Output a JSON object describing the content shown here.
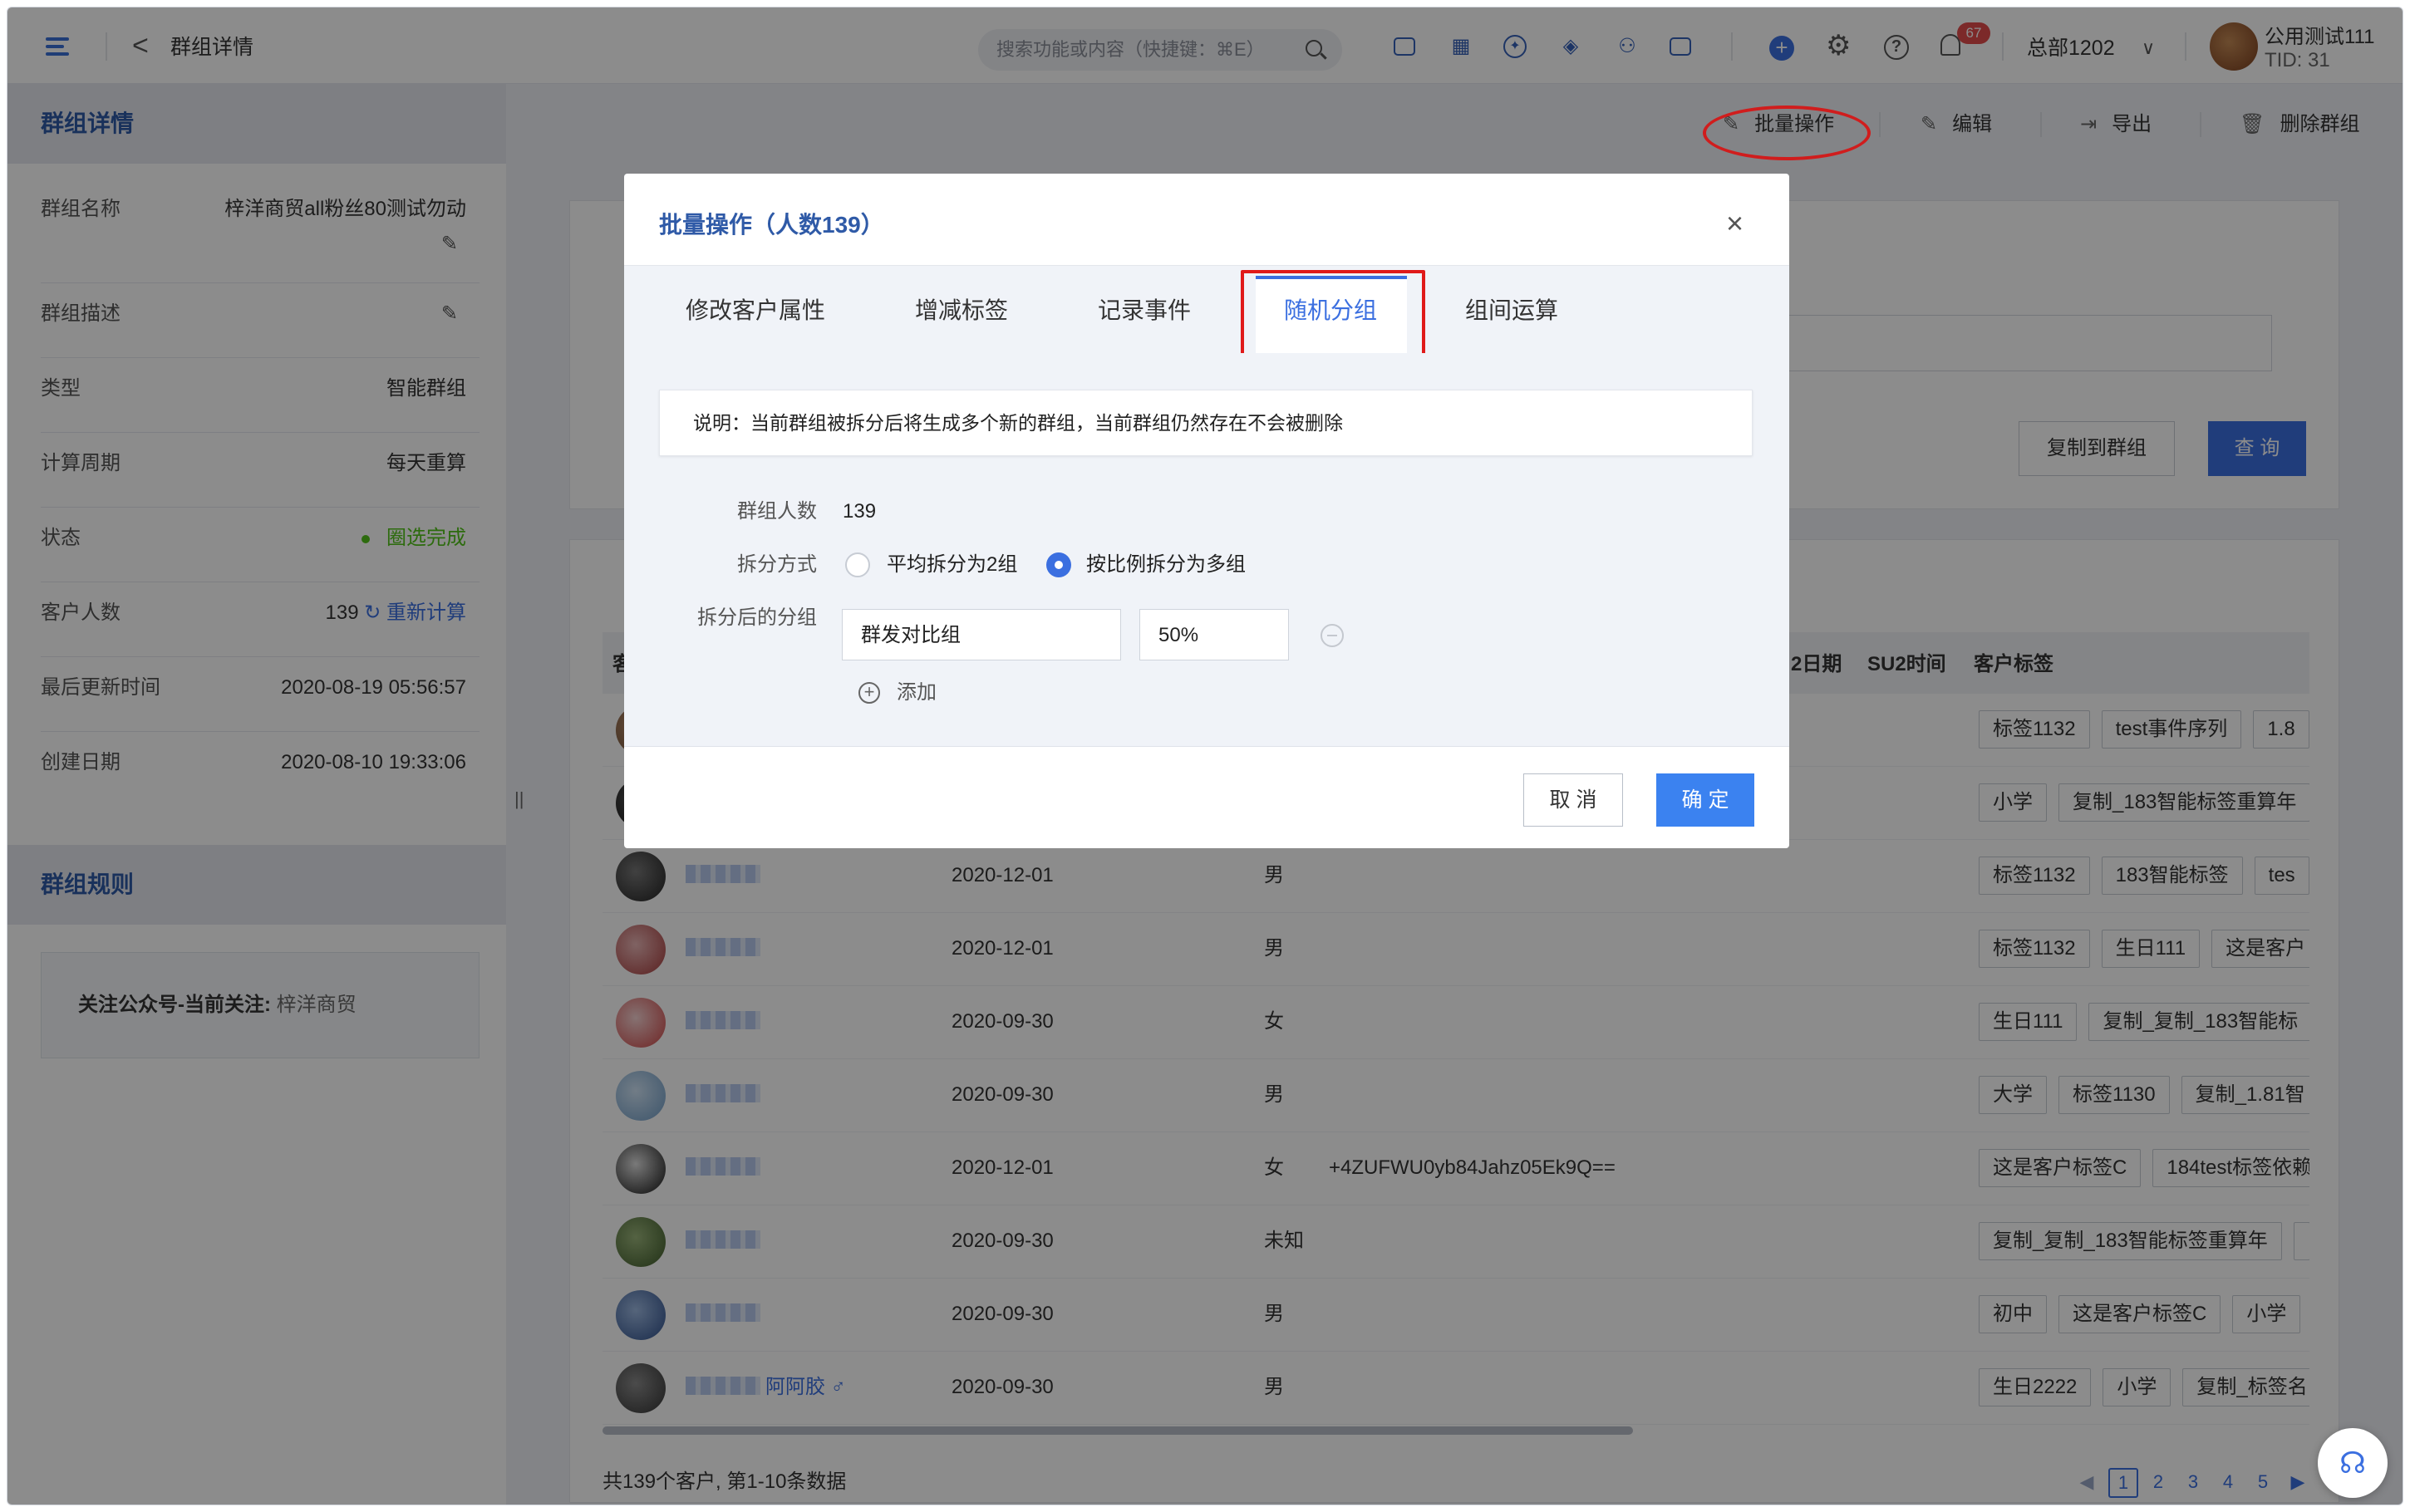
{
  "topbar": {
    "page_title": "群组详情",
    "back_glyph": "<",
    "search_placeholder": "搜索功能或内容（快捷键：⌘E）",
    "notifications_badge": "67",
    "org_name": "总部1202",
    "user_name": "公用测试111",
    "user_tid": "TID: 31"
  },
  "left_panel": {
    "section_title": "群组详情",
    "fields": [
      {
        "label": "群组名称",
        "value": "梓洋商贸all粉丝80测试勿动"
      },
      {
        "label": "群组描述",
        "value": ""
      },
      {
        "label": "类型",
        "value": "智能群组"
      },
      {
        "label": "计算周期",
        "value": "每天重算"
      },
      {
        "label": "状态",
        "value": "圈选完成"
      },
      {
        "label": "客户人数",
        "value": "139",
        "action": "重新计算"
      },
      {
        "label": "最后更新时间",
        "value": "2020-08-19 05:56:57"
      },
      {
        "label": "创建日期",
        "value": "2020-08-10 19:33:06"
      }
    ],
    "rules_title": "群组规则",
    "rule_label": "关注公众号-当前关注:",
    "rule_value": "梓洋商贸"
  },
  "actions": {
    "batch": "批量操作",
    "edit": "编辑",
    "export": "导出",
    "delete": "删除群组"
  },
  "query_card": {
    "copy_button": "复制到群组",
    "query_button": "查 询"
  },
  "table": {
    "headers": [
      "客",
      "2日期",
      "SU2时间",
      "客户标签"
    ],
    "rows": [
      {
        "date": "",
        "gender": "",
        "openid": "",
        "tags": [
          "标签1132",
          "test事件序列",
          "1.8"
        ]
      },
      {
        "date": "",
        "gender": "",
        "openid": "",
        "tags": [
          "小学",
          "复制_183智能标签重算年"
        ]
      },
      {
        "date": "2020-12-01",
        "gender": "男",
        "openid": "",
        "tags": [
          "标签1132",
          "183智能标签",
          "tes"
        ]
      },
      {
        "date": "2020-12-01",
        "gender": "男",
        "openid": "",
        "tags": [
          "标签1132",
          "生日111",
          "这是客户"
        ]
      },
      {
        "date": "2020-09-30",
        "gender": "女",
        "openid": "",
        "tags": [
          "生日111",
          "复制_复制_183智能标"
        ]
      },
      {
        "date": "2020-09-30",
        "gender": "男",
        "openid": "",
        "tags": [
          "大学",
          "标签1130",
          "复制_1.81智"
        ]
      },
      {
        "date": "2020-12-01",
        "gender": "女",
        "openid": "+4ZUFWU0yb84Jahz05Ek9Q==",
        "tags": [
          "这是客户标签C",
          "184test标签依赖"
        ]
      },
      {
        "date": "2020-09-30",
        "gender": "未知",
        "openid": "",
        "tags": [
          "复制_复制_183智能标签重算年",
          ""
        ]
      },
      {
        "date": "2020-09-30",
        "gender": "男",
        "openid": "",
        "tags": [
          "初中",
          "这是客户标签C",
          "小学"
        ]
      },
      {
        "date": "2020-09-30",
        "gender": "男",
        "openid": "",
        "name_suffix": "阿阿胶 ♂",
        "tags": [
          "生日2222",
          "小学",
          "复制_标签名"
        ]
      }
    ],
    "total": "共139个客户, 第1-10条数据",
    "pages": [
      "1",
      "2",
      "3",
      "4",
      "5"
    ]
  },
  "modal": {
    "title": "批量操作（人数139）",
    "tabs": [
      "修改客户属性",
      "增减标签",
      "记录事件",
      "随机分组",
      "组间运算"
    ],
    "active_tab": "随机分组",
    "note": "说明：当前群组被拆分后将生成多个新的群组，当前群组仍然存在不会被删除",
    "count_label": "群组人数",
    "count_value": "139",
    "split_label": "拆分方式",
    "split_options": [
      "平均拆分为2组",
      "按比例拆分为多组"
    ],
    "split_selected": "按比例拆分为多组",
    "groups_label": "拆分后的分组",
    "group_name": "群发对比组",
    "group_ratio": "50%",
    "add_label": "添加",
    "cancel": "取 消",
    "ok": "确 定"
  },
  "colors": {
    "accent": "#3b6fe0",
    "annotation_red": "#e01a1a",
    "status_green": "#52c41a"
  }
}
